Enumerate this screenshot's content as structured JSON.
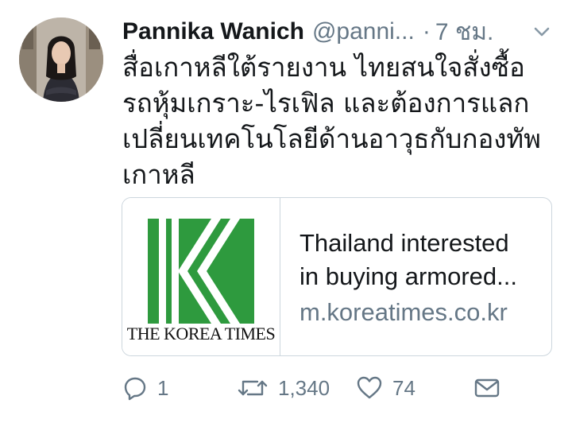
{
  "tweet": {
    "author_name": "Pannika Wanich",
    "handle": "@panni...",
    "separator": "·",
    "time": "7 ชม.",
    "text_lines": [
      "สื่อเกาหลีใต้รายงาน ไทยสนใจสั่งซื้อ",
      "รถหุ้มเกราะ-ไรเฟิล และต้องการแลก",
      "เปลี่ยนเทคโนโลยีด้านอาวุธกับกองทัพ",
      "เกาหลี"
    ]
  },
  "card": {
    "logo_text": "THE KOREA TIMES",
    "title_lines": [
      "Thailand interested",
      "in buying armored..."
    ],
    "domain": "m.koreatimes.co.kr",
    "logo_color": "#2e9a3e"
  },
  "actions": {
    "reply_count": "1",
    "retweet_count": "1,340",
    "like_count": "74"
  },
  "icons": [
    "chevron-down-icon",
    "reply-icon",
    "retweet-icon",
    "heart-icon",
    "envelope-icon"
  ]
}
